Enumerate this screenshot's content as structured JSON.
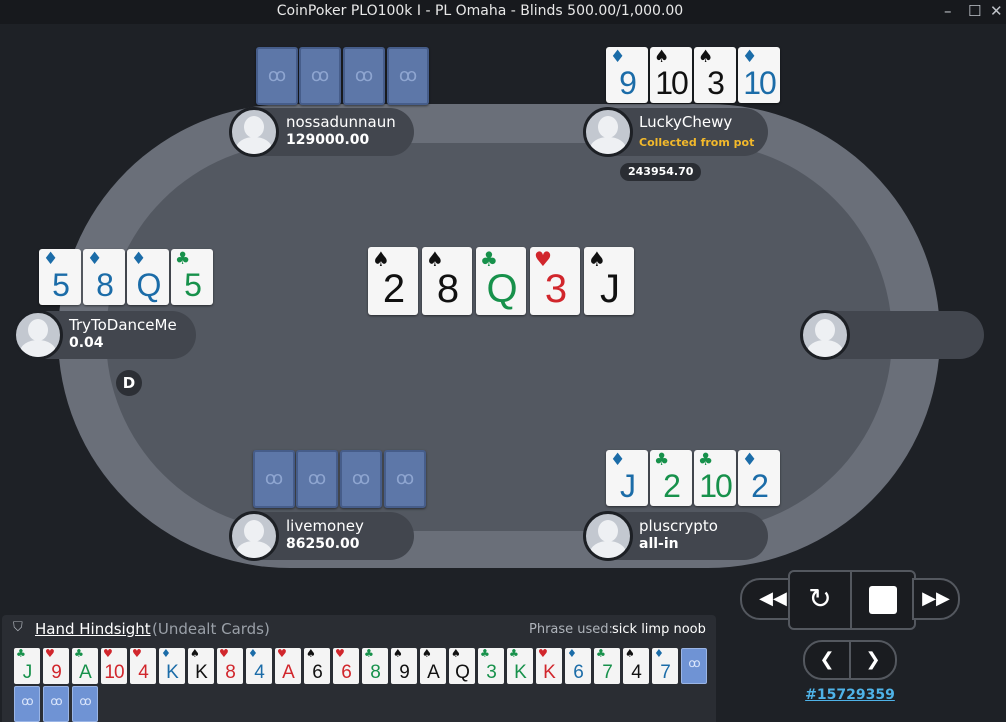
{
  "window": {
    "title": "CoinPoker PLO100k I - PL Omaha - Blinds 500.00/1,000.00"
  },
  "suits": {
    "s": "♠",
    "h": "♥",
    "c": "♣",
    "d": "♦",
    "back": "ꝏ"
  },
  "players": [
    {
      "id": "nossadunnaun",
      "name": "nossadunnaun",
      "value": "129000.00",
      "status": ""
    },
    {
      "id": "luckychewy",
      "name": "LuckyChewy",
      "value": "",
      "status": "Collected from pot"
    },
    {
      "id": "trytodanceme",
      "name": "TryToDanceMe",
      "value": "0.04",
      "status": ""
    },
    {
      "id": "empty-seat",
      "name": "",
      "value": "",
      "status": ""
    },
    {
      "id": "livemoney",
      "name": "livemoney",
      "value": "86250.00",
      "status": ""
    },
    {
      "id": "pluscrypto",
      "name": "pluscrypto",
      "value": "all-in",
      "status": ""
    }
  ],
  "hands": {
    "luckychewy": [
      {
        "rank": "9",
        "suit": "d"
      },
      {
        "rank": "10",
        "suit": "s"
      },
      {
        "rank": "3",
        "suit": "s"
      },
      {
        "rank": "10",
        "suit": "d"
      }
    ],
    "trytodanceme": [
      {
        "rank": "5",
        "suit": "d"
      },
      {
        "rank": "8",
        "suit": "d"
      },
      {
        "rank": "Q",
        "suit": "d"
      },
      {
        "rank": "5",
        "suit": "c"
      }
    ],
    "pluscrypto": [
      {
        "rank": "J",
        "suit": "d"
      },
      {
        "rank": "2",
        "suit": "c"
      },
      {
        "rank": "10",
        "suit": "c"
      },
      {
        "rank": "2",
        "suit": "d"
      }
    ]
  },
  "board": [
    {
      "rank": "2",
      "suit": "s"
    },
    {
      "rank": "8",
      "suit": "s"
    },
    {
      "rank": "Q",
      "suit": "c"
    },
    {
      "rank": "3",
      "suit": "h"
    },
    {
      "rank": "J",
      "suit": "s"
    }
  ],
  "pot_collected": "243954.70",
  "dealer_button": "D",
  "hindsight": {
    "title": "Hand Hindsight",
    "subtitle": "(Undealt Cards)",
    "phrase_label": "Phrase used:",
    "phrase": "sick limp noob",
    "cards": [
      {
        "rank": "J",
        "suit": "c"
      },
      {
        "rank": "9",
        "suit": "h"
      },
      {
        "rank": "A",
        "suit": "c"
      },
      {
        "rank": "10",
        "suit": "h"
      },
      {
        "rank": "4",
        "suit": "h"
      },
      {
        "rank": "K",
        "suit": "d"
      },
      {
        "rank": "K",
        "suit": "s"
      },
      {
        "rank": "8",
        "suit": "h"
      },
      {
        "rank": "4",
        "suit": "d"
      },
      {
        "rank": "A",
        "suit": "h"
      },
      {
        "rank": "6",
        "suit": "s"
      },
      {
        "rank": "6",
        "suit": "h"
      },
      {
        "rank": "8",
        "suit": "c"
      },
      {
        "rank": "9",
        "suit": "s"
      },
      {
        "rank": "A",
        "suit": "s"
      },
      {
        "rank": "Q",
        "suit": "s"
      },
      {
        "rank": "3",
        "suit": "c"
      },
      {
        "rank": "K",
        "suit": "c"
      },
      {
        "rank": "K",
        "suit": "h"
      },
      {
        "rank": "6",
        "suit": "d"
      },
      {
        "rank": "7",
        "suit": "c"
      },
      {
        "rank": "4",
        "suit": "s"
      },
      {
        "rank": "7",
        "suit": "d"
      }
    ]
  },
  "hand_id": "#15729359",
  "colors": {
    "spade": "#111111",
    "heart": "#d1262c",
    "club": "#17914b",
    "diamond": "#1b6ca8",
    "status": "#f3b92b",
    "link": "#4fb3e8"
  }
}
